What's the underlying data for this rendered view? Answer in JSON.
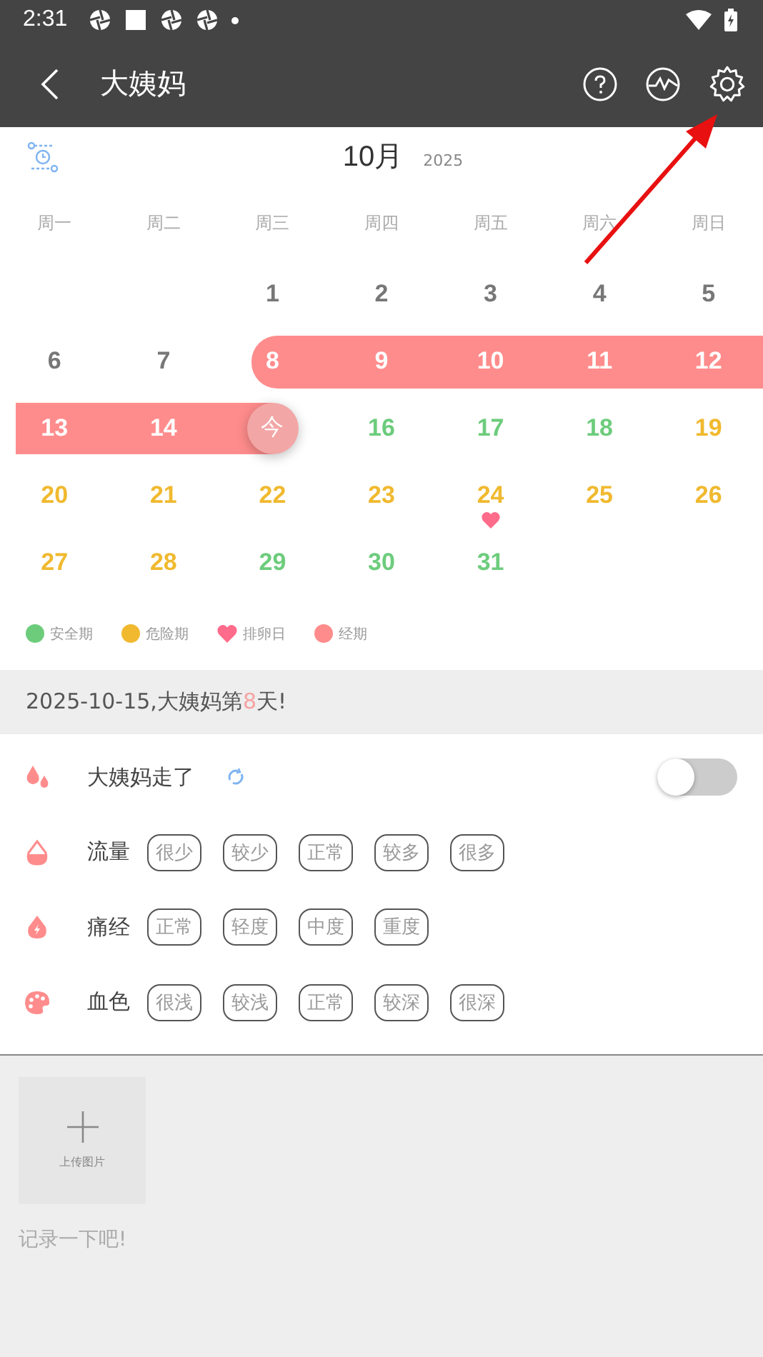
{
  "status_bar": {
    "time": "2:31"
  },
  "app_bar": {
    "title": "大姨妈"
  },
  "calendar": {
    "month": "10月",
    "year": "2025",
    "weekdays": [
      "周一",
      "周二",
      "周三",
      "周四",
      "周五",
      "周六",
      "周日"
    ],
    "weeks": [
      {
        "kind": "first",
        "days": [
          {
            "label": "1",
            "kind": "neutral",
            "in_period": false,
            "today": false,
            "ovulation": false
          },
          {
            "label": "2",
            "kind": "neutral",
            "in_period": false,
            "today": false,
            "ovulation": false
          },
          {
            "label": "3",
            "kind": "neutral",
            "in_period": false,
            "today": false,
            "ovulation": false
          },
          {
            "label": "4",
            "kind": "neutral",
            "in_period": false,
            "today": false,
            "ovulation": false
          },
          {
            "label": "5",
            "kind": "neutral",
            "in_period": false,
            "today": false,
            "ovulation": false
          }
        ]
      },
      {
        "kind": "regular",
        "days": [
          {
            "label": "6",
            "kind": "neutral",
            "in_period": false,
            "today": false,
            "ovulation": false
          },
          {
            "label": "7",
            "kind": "neutral",
            "in_period": false,
            "today": false,
            "ovulation": false
          },
          {
            "label": "8",
            "kind": "period",
            "in_period": true,
            "today": false,
            "ovulation": false
          },
          {
            "label": "9",
            "kind": "period",
            "in_period": true,
            "today": false,
            "ovulation": false
          },
          {
            "label": "10",
            "kind": "period",
            "in_period": true,
            "today": false,
            "ovulation": false
          },
          {
            "label": "11",
            "kind": "period",
            "in_period": true,
            "today": false,
            "ovulation": false
          },
          {
            "label": "12",
            "kind": "period",
            "in_period": true,
            "today": false,
            "ovulation": false
          }
        ]
      },
      {
        "kind": "regular",
        "days": [
          {
            "label": "13",
            "kind": "period",
            "in_period": true,
            "today": false,
            "ovulation": false
          },
          {
            "label": "14",
            "kind": "period",
            "in_period": true,
            "today": false,
            "ovulation": false
          },
          {
            "label": "今",
            "kind": "period",
            "in_period": true,
            "today": true,
            "ovulation": false
          },
          {
            "label": "16",
            "kind": "safe",
            "in_period": false,
            "today": false,
            "ovulation": false
          },
          {
            "label": "17",
            "kind": "safe",
            "in_period": false,
            "today": false,
            "ovulation": false
          },
          {
            "label": "18",
            "kind": "safe",
            "in_period": false,
            "today": false,
            "ovulation": false
          },
          {
            "label": "19",
            "kind": "danger",
            "in_period": false,
            "today": false,
            "ovulation": false
          }
        ]
      },
      {
        "kind": "regular",
        "days": [
          {
            "label": "20",
            "kind": "danger",
            "in_period": false,
            "today": false,
            "ovulation": false
          },
          {
            "label": "21",
            "kind": "danger",
            "in_period": false,
            "today": false,
            "ovulation": false
          },
          {
            "label": "22",
            "kind": "danger",
            "in_period": false,
            "today": false,
            "ovulation": false
          },
          {
            "label": "23",
            "kind": "danger",
            "in_period": false,
            "today": false,
            "ovulation": false
          },
          {
            "label": "24",
            "kind": "danger",
            "in_period": false,
            "today": false,
            "ovulation": true
          },
          {
            "label": "25",
            "kind": "danger",
            "in_period": false,
            "today": false,
            "ovulation": false
          },
          {
            "label": "26",
            "kind": "danger",
            "in_period": false,
            "today": false,
            "ovulation": false
          }
        ]
      },
      {
        "kind": "last",
        "days": [
          {
            "label": "27",
            "kind": "danger",
            "in_period": false,
            "today": false,
            "ovulation": false
          },
          {
            "label": "28",
            "kind": "danger",
            "in_period": false,
            "today": false,
            "ovulation": false
          },
          {
            "label": "29",
            "kind": "safe",
            "in_period": false,
            "today": false,
            "ovulation": false
          },
          {
            "label": "30",
            "kind": "safe",
            "in_period": false,
            "today": false,
            "ovulation": false
          },
          {
            "label": "31",
            "kind": "safe",
            "in_period": false,
            "today": false,
            "ovulation": false
          }
        ]
      }
    ],
    "legend": [
      {
        "label": "安全期",
        "kind": "dot",
        "color": "#6dcc7c"
      },
      {
        "label": "危险期",
        "kind": "dot",
        "color": "#f0b92f"
      },
      {
        "label": "排卵日",
        "kind": "heart",
        "color": "#ff6b8a"
      },
      {
        "label": "经期",
        "kind": "dot",
        "color": "#ff8c8c"
      }
    ]
  },
  "summary": {
    "parts": [
      {
        "text": "2025-10-15,大姨妈第",
        "highlight": false
      },
      {
        "text": "8",
        "highlight": true
      },
      {
        "text": "天!",
        "highlight": false
      }
    ]
  },
  "records": [
    {
      "kind": "toggle",
      "label": "大姨妈走了",
      "on": false
    },
    {
      "kind": "options",
      "label": "流量",
      "options": [
        {
          "label": "很少",
          "selected": false
        },
        {
          "label": "较少",
          "selected": false
        },
        {
          "label": "正常",
          "selected": false
        },
        {
          "label": "较多",
          "selected": false
        },
        {
          "label": "很多",
          "selected": false
        }
      ]
    },
    {
      "kind": "options",
      "label": "痛经",
      "options": [
        {
          "label": "正常",
          "selected": false
        },
        {
          "label": "轻度",
          "selected": false
        },
        {
          "label": "中度",
          "selected": false
        },
        {
          "label": "重度",
          "selected": false
        }
      ]
    },
    {
      "kind": "options",
      "label": "血色",
      "options": [
        {
          "label": "很浅",
          "selected": false
        },
        {
          "label": "较浅",
          "selected": false
        },
        {
          "label": "正常",
          "selected": false
        },
        {
          "label": "较深",
          "selected": false
        },
        {
          "label": "很深",
          "selected": false
        }
      ]
    }
  ],
  "notes": {
    "upload_label": "上传图片",
    "placeholder": "记录一下吧!"
  }
}
